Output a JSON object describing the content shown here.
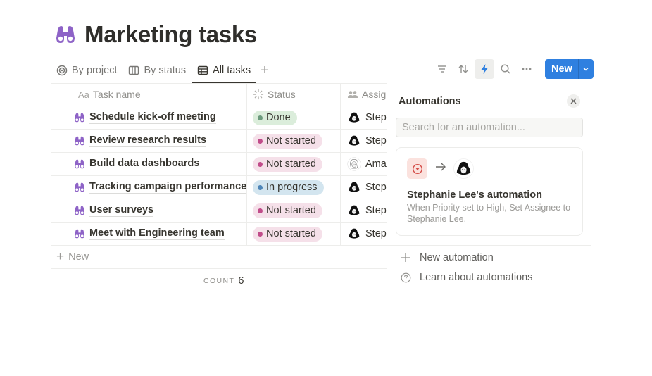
{
  "page": {
    "title": "Marketing tasks",
    "icon": "binoculars-icon",
    "accent_color": "#8e63c7"
  },
  "tabs": [
    {
      "label": "By project",
      "icon": "target-icon",
      "active": false
    },
    {
      "label": "By status",
      "icon": "board-icon",
      "active": false
    },
    {
      "label": "All tasks",
      "icon": "table-icon",
      "active": true
    }
  ],
  "tab_add_label": "+",
  "toolbar": {
    "icons": [
      "filter-icon",
      "sort-icon",
      "lightning-icon",
      "search-icon",
      "more-icon"
    ],
    "new_label": "New",
    "new_color": "#2f80e0"
  },
  "table": {
    "columns": [
      {
        "label": "Task name",
        "icon_text": "Aa"
      },
      {
        "label": "Status",
        "icon": "status-icon"
      },
      {
        "label": "Assig",
        "icon": "people-icon"
      }
    ],
    "rows": [
      {
        "name": "Schedule kick-off meeting",
        "status": "Done",
        "assignee": "Step"
      },
      {
        "name": "Review research results",
        "status": "Not started",
        "assignee": "Step"
      },
      {
        "name": "Build data dashboards",
        "status": "Not started",
        "assignee": "Amay"
      },
      {
        "name": "Tracking campaign performance",
        "status": "In progress",
        "assignee": "Step"
      },
      {
        "name": "User surveys",
        "status": "Not started",
        "assignee": "Step"
      },
      {
        "name": "Meet with Engineering team",
        "status": "Not started",
        "assignee": "Step"
      }
    ],
    "status_colors": {
      "Done": {
        "bg": "#dbeddb",
        "dot": "#6c9b7d"
      },
      "Not started": {
        "bg": "#f5e0e9",
        "dot": "#c14c8a"
      },
      "In progress": {
        "bg": "#d3e5ef",
        "dot": "#4f86b8"
      }
    },
    "add_label": "New",
    "count_label": "COUNT",
    "count_value": "6"
  },
  "automations": {
    "title": "Automations",
    "search_placeholder": "Search for an automation...",
    "card": {
      "title": "Stephanie Lee's automation",
      "description": "When Priority set to High, Set Assignee to Stephanie Lee."
    },
    "menu": [
      {
        "label": "New automation",
        "icon": "plus-icon"
      },
      {
        "label": "Learn about automations",
        "icon": "help-icon"
      }
    ]
  }
}
